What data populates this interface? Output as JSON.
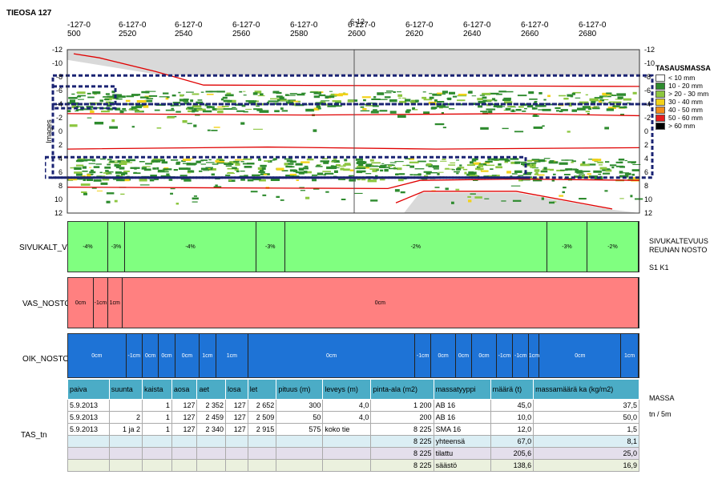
{
  "title": "TIEOSA 127",
  "top_ticks": [
    {
      "l1": "-127-0",
      "l2": "500"
    },
    {
      "l1": "6-127-0",
      "l2": "2520"
    },
    {
      "l1": "6-127-0",
      "l2": "2540"
    },
    {
      "l1": "6-127-0",
      "l2": "2560"
    },
    {
      "l1": "6-127-0",
      "l2": "2580"
    },
    {
      "l1": "6-127-0",
      "l2": "2600"
    },
    {
      "l1": "6-127-0",
      "l2": "2620"
    },
    {
      "l1": "6-127-0",
      "l2": "2640"
    },
    {
      "l1": "6-127-0",
      "l2": "2660"
    },
    {
      "l1": "6-127-0",
      "l2": "2680"
    }
  ],
  "cursor_label": "6-12",
  "chart_data": {
    "type": "heatmap",
    "title": "TIEOSA 127",
    "ylabel": "Images",
    "ylim": [
      12,
      -12
    ],
    "left_ticks": [
      "-12",
      "-10",
      "-8",
      "-6",
      "-4",
      "-2",
      "0",
      "2",
      "4",
      "6",
      "8",
      "10",
      "12"
    ],
    "right_ticks": [
      "-12",
      "-10",
      "-8",
      "-6",
      "-4",
      "-2",
      "0",
      "2",
      "4",
      "6",
      "8",
      "10",
      "12"
    ],
    "legend_title": "TASAUSMASSA",
    "legend": [
      {
        "label": "< 10 mm",
        "color": "#ffffff"
      },
      {
        "label": "10 - 20 mm",
        "color": "#2e8b2e"
      },
      {
        "label": "> 20 - 30 mm",
        "color": "#8cc63f"
      },
      {
        "label": "30 - 40 mm",
        "color": "#f2d21a"
      },
      {
        "label": "40 - 50 mm",
        "color": "#f28c1a"
      },
      {
        "label": "50 - 60 mm",
        "color": "#e61e1e"
      },
      {
        "label": "> 60 mm",
        "color": "#000000"
      }
    ]
  },
  "sivukalt": {
    "label": "SIVUKALT_V",
    "right_label1": "SIVUKALTEVUUS",
    "right_label2": "REUNAN NOSTO",
    "right_label3": "S1 K1",
    "color": "#80ff80",
    "segments": [
      {
        "text": "-4%",
        "w": 7
      },
      {
        "text": "-3%",
        "w": 3
      },
      {
        "text": "-4%",
        "w": 23
      },
      {
        "text": "-3%",
        "w": 5
      },
      {
        "text": "-2%",
        "w": 46
      },
      {
        "text": "-3%",
        "w": 7
      },
      {
        "text": "-2%",
        "w": 9
      }
    ]
  },
  "vas": {
    "label": "VAS_NOSTO",
    "color": "#ff8080",
    "segments": [
      {
        "text": "0cm",
        "w": 4.5
      },
      {
        "text": "-1cm",
        "w": 2.5
      },
      {
        "text": "1cm",
        "w": 2.5
      },
      {
        "text": "0cm",
        "w": 90.5
      }
    ]
  },
  "oik": {
    "label": "OIK_NOSTO",
    "color": "#1e73d6",
    "segments": [
      {
        "text": "0cm",
        "w": 10
      },
      {
        "text": "-1cm",
        "w": 2.8
      },
      {
        "text": "0cm",
        "w": 2.8
      },
      {
        "text": "0cm",
        "w": 2.8
      },
      {
        "text": "0cm",
        "w": 4.2
      },
      {
        "text": "1cm",
        "w": 2.8
      },
      {
        "text": "1cm",
        "w": 5.6
      },
      {
        "text": "0cm",
        "w": 28.6
      },
      {
        "text": "-1cm",
        "w": 2.8
      },
      {
        "text": "0cm",
        "w": 4.2
      },
      {
        "text": "0cm",
        "w": 2.8
      },
      {
        "text": "0cm",
        "w": 4.2
      },
      {
        "text": "-1cm",
        "w": 2.8
      },
      {
        "text": "-1cm",
        "w": 2.8
      },
      {
        "text": "1cm",
        "w": 1.8
      },
      {
        "text": "0cm",
        "w": 14
      },
      {
        "text": "1cm",
        "w": 3
      }
    ]
  },
  "tas": {
    "label": "TAS_tn",
    "right_label1": "MASSA",
    "right_label2": "tn / 5m",
    "headers": [
      "paiva",
      "suunta",
      "kaista",
      "aosa",
      "aet",
      "losa",
      "let",
      "pituus (m)",
      "leveys (m)",
      "pinta-ala (m2)",
      "massatyyppi",
      "määrä (t)",
      "massamäärä ka (kg/m2)"
    ],
    "rows": [
      [
        "5.9.2013",
        "",
        "1",
        "127",
        "2 352",
        "127",
        "2 652",
        "300",
        "4,0",
        "1 200",
        "AB 16",
        "45,0",
        "37,5"
      ],
      [
        "5.9.2013",
        "2",
        "1",
        "127",
        "2 459",
        "127",
        "2 509",
        "50",
        "4,0",
        "200",
        "AB 16",
        "10,0",
        "50,0"
      ],
      [
        "5.9.2013",
        "1 ja 2",
        "1",
        "127",
        "2 340",
        "127",
        "2 915",
        "575",
        "koko tie",
        "8 225",
        "SMA 16",
        "12,0",
        "1,5"
      ]
    ],
    "summary": [
      {
        "area": "8 225",
        "label": "yhteensä",
        "amount": "67,0",
        "avg": "8,1",
        "color": "#dbeef4"
      },
      {
        "area": "8 225",
        "label": "tilattu",
        "amount": "205,6",
        "avg": "25,0",
        "color": "#e4dfec"
      },
      {
        "area": "8 225",
        "label": "säästö",
        "amount": "138,6",
        "avg": "16,9",
        "color": "#ebf1de"
      }
    ]
  }
}
